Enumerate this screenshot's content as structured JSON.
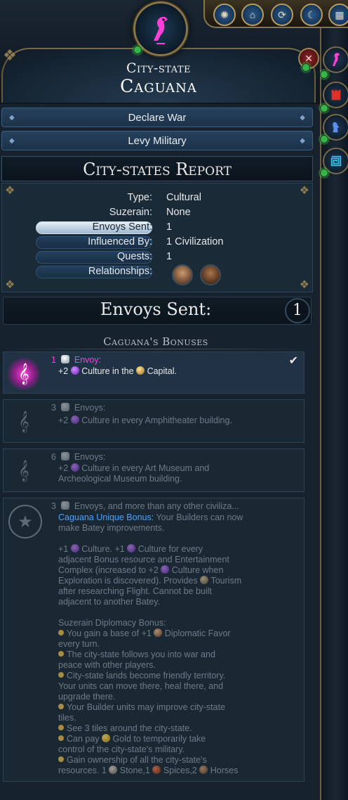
{
  "header": {
    "subtitle": "City-state",
    "name": "Caguana",
    "emblem_icon": "cultural-citystate-bird-icon",
    "close_icon": "close-icon"
  },
  "toolbar": {
    "buttons": [
      "science-icon",
      "culture-icon",
      "cycle-icon",
      "moon-icon",
      "city-states-icon"
    ]
  },
  "actions": {
    "declare_war": "Declare War",
    "levy_military": "Levy Military"
  },
  "report": {
    "title": "City-states Report",
    "type_label": "Type:",
    "type_value": "Cultural",
    "suzerain_label": "Suzerain:",
    "suzerain_value": "None",
    "envoys_label": "Envoys Sent:",
    "envoys_value": "1",
    "influenced_label": "Influenced By:",
    "influenced_value": "1 Civilization",
    "quests_label": "Quests:",
    "quests_value": "1",
    "relationships_label": "Relationships:"
  },
  "envoys": {
    "label": "Envoys Sent:",
    "count": "1"
  },
  "bonuses": {
    "heading": "Caguana's Bonuses",
    "b1": {
      "count": "1",
      "label": "Envoy:",
      "pre": "+2",
      "mid": "Culture in the",
      "post": "Capital."
    },
    "b3": {
      "count": "3",
      "label": "Envoys:",
      "pre": "+2",
      "text": "Culture in every Amphitheater building."
    },
    "b6": {
      "count": "6",
      "label": "Envoys:",
      "pre": "+2",
      "line1": "Culture in every Art Museum and",
      "line2": "Archeological Museum building."
    },
    "suz": {
      "count": "3",
      "label": "Envoys, and more than any other civiliza...",
      "unique_title": "Caguana Unique Bonus:",
      "unique_rest": "Your Builders can now",
      "unique_line2": "make Batey improvements.",
      "p2_a": "+1",
      "p2_b": "Culture. +1",
      "p2_c": "Culture for every",
      "p2_line2": "adjacent Bonus resource and Entertainment",
      "p2_line3a": "Complex (increased to +2",
      "p2_line3b": "Culture when",
      "p2_line4a": "Exploration is discovered). Provides",
      "p2_line4b": "Tourism",
      "p2_line5": "after researching Flight. Cannot be built",
      "p2_line6": "adjacent to another Batey.",
      "dip_title": "Suzerain Diplomacy Bonus:",
      "d1a": "You gain a base of +1",
      "d1b": "Diplomatic Favor",
      "d1c": "every turn.",
      "d2a": "The city-state follows you into war and",
      "d2b": "peace with other players.",
      "d3a": "City-state lands become friendly territory.",
      "d3b": "Your units can move there, heal there, and",
      "d3c": "upgrade there.",
      "d4a": "Your Builder units may improve city-state",
      "d4b": "tiles.",
      "d5": "See 3 tiles around the city-state.",
      "d6a": "Can pay",
      "d6b": "Gold to temporarily take",
      "d6c": "control of the city-state's military.",
      "d7a": "Gain ownership of all the city-state's",
      "d7b": "resources. 1",
      "d7c": "Stone,1",
      "d7d": "Spices,2",
      "d7e": "Horses"
    }
  },
  "side": {
    "buttons": [
      "cultural-citystate-icon",
      "militaristic-citystate-icon",
      "religious-citystate-icon",
      "trade-citystate-icon"
    ]
  },
  "colors": {
    "cultural": "#ff3fd8",
    "unique_bonus_blue": "#4aa3ff",
    "gold_trim": "#8a7548"
  }
}
